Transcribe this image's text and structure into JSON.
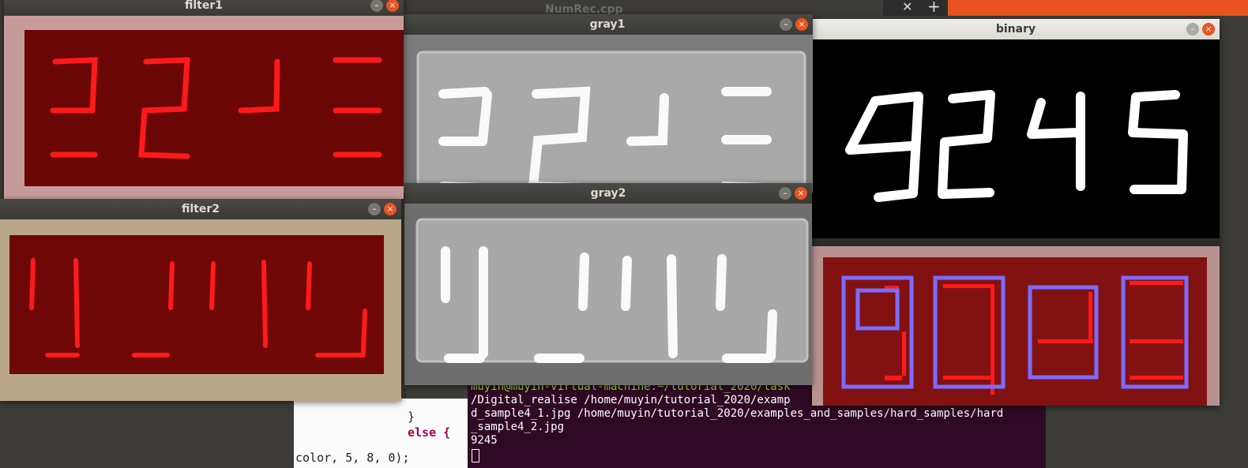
{
  "background_editor": {
    "title": "NumRec.cpp",
    "code_lines": [
      "}",
      "else {",
      "color, 5, 8, 0);",
      ";"
    ]
  },
  "browser_strip": {
    "close_glyph": "✕",
    "new_tab_glyph": "+"
  },
  "windows": {
    "filter1": {
      "title": "filter1",
      "digits_shown": "22J3"
    },
    "filter2": {
      "title": "filter2",
      "digits_shown": "9_115"
    },
    "gray1": {
      "title": "gray1"
    },
    "gray2": {
      "title": "gray2"
    },
    "binary": {
      "title": "binary",
      "digits": "9245"
    }
  },
  "terminal": {
    "lines": [
      "muyin@muyin-virtual-machine:~/tutorial_2020/task",
      "/Digital_realise /home/muyin/tutorial_2020/examp",
      "d_sample4_1.jpg /home/muyin/tutorial_2020/examples_and_samples/hard_samples/hard",
      "_sample4_2.jpg",
      "9245"
    ]
  },
  "controls": {
    "minimize_glyph": "–",
    "close_glyph": "×"
  },
  "colors": {
    "ubuntu_orange": "#e95420",
    "terminal_bg": "#300a24",
    "led_red": "#ff1a1a",
    "box_purple": "#7b6cff"
  }
}
